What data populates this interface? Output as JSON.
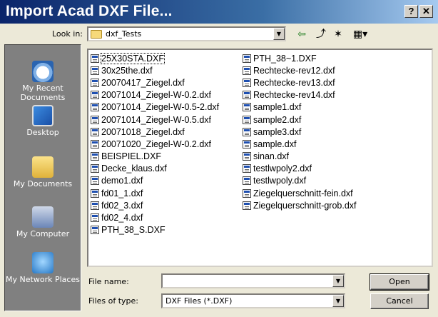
{
  "window": {
    "title": "Import Acad DXF File...",
    "help_label": "?",
    "close_label": "✕"
  },
  "lookin": {
    "label": "Look in:",
    "value": "dxf_Tests",
    "arrow": "▼"
  },
  "toolbar": {
    "back_icon": "back-arrow-icon",
    "up_icon": "up-folder-icon",
    "new_icon": "new-folder-icon",
    "view_icon": "view-menu-icon"
  },
  "places": [
    {
      "label": "My Recent Documents",
      "icon": "recent-documents-icon"
    },
    {
      "label": "Desktop",
      "icon": "desktop-icon"
    },
    {
      "label": "My Documents",
      "icon": "my-documents-icon"
    },
    {
      "label": "My Computer",
      "icon": "my-computer-icon"
    },
    {
      "label": "My Network Places",
      "icon": "network-places-icon"
    }
  ],
  "files_col1": [
    "25X30STA.DXF",
    "30x25the.dxf",
    "20070417_Ziegel.dxf",
    "20071014_Ziegel-W-0.2.dxf",
    "20071014_Ziegel-W-0.5-2.dxf",
    "20071014_Ziegel-W-0.5.dxf",
    "20071018_Ziegel.dxf",
    "20071020_Ziegel-W-0.2.dxf",
    "BEISPIEL.DXF",
    "Decke_klaus.dxf",
    "demo1.dxf",
    "fd01_1.dxf",
    "fd02_3.dxf",
    "fd02_4.dxf",
    "PTH_38_S.DXF"
  ],
  "files_col2": [
    "PTH_38~1.DXF",
    "Rechtecke-rev12.dxf",
    "Rechtecke-rev13.dxf",
    "Rechtecke-rev14.dxf",
    "sample1.dxf",
    "sample2.dxf",
    "sample3.dxf",
    "sample.dxf",
    "sinan.dxf",
    "testlwpoly2.dxf",
    "testlwpoly.dxf",
    "Ziegelquerschnitt-fein.dxf",
    "Ziegelquerschnitt-grob.dxf"
  ],
  "filename": {
    "label": "File name:",
    "value": ""
  },
  "filetype": {
    "label": "Files of type:",
    "value": "DXF Files (*.DXF)"
  },
  "buttons": {
    "open": "Open",
    "cancel": "Cancel"
  }
}
